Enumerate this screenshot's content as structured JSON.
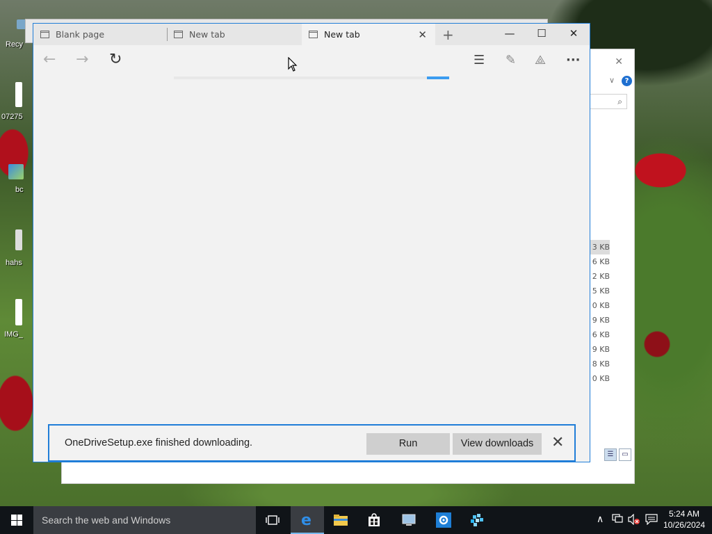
{
  "desktop": {
    "icons": [
      {
        "label": "Recy"
      },
      {
        "label": "07275"
      },
      {
        "label": "bc"
      },
      {
        "label": "hahs"
      },
      {
        "label": "IMG_"
      }
    ]
  },
  "explorer": {
    "file_sizes": [
      "3 KB",
      "6 KB",
      "2 KB",
      "5 KB",
      "0 KB",
      "9 KB",
      "6 KB",
      "9 KB",
      "8 KB",
      "0 KB"
    ]
  },
  "browser": {
    "tabs": [
      {
        "label": "Blank page",
        "active": false
      },
      {
        "label": "New tab",
        "active": false
      },
      {
        "label": "New tab",
        "active": true
      }
    ],
    "new_tab_symbol": "+",
    "window_controls": {
      "minimize": "—",
      "maximize": "☐",
      "close": "✕"
    },
    "nav": {
      "back": "←",
      "forward": "→",
      "refresh": "↻"
    },
    "tools": {
      "hub": "☰",
      "note": "✎",
      "share": "⟁",
      "more": "···"
    },
    "progress": 0.08,
    "download": {
      "message": "OneDriveSetup.exe finished downloading.",
      "run_label": "Run",
      "view_label": "View downloads",
      "close_symbol": "✕"
    }
  },
  "taskbar": {
    "search_placeholder": "Search the web and Windows",
    "clock": {
      "time": "5:24 AM",
      "date": "10/26/2024"
    }
  }
}
